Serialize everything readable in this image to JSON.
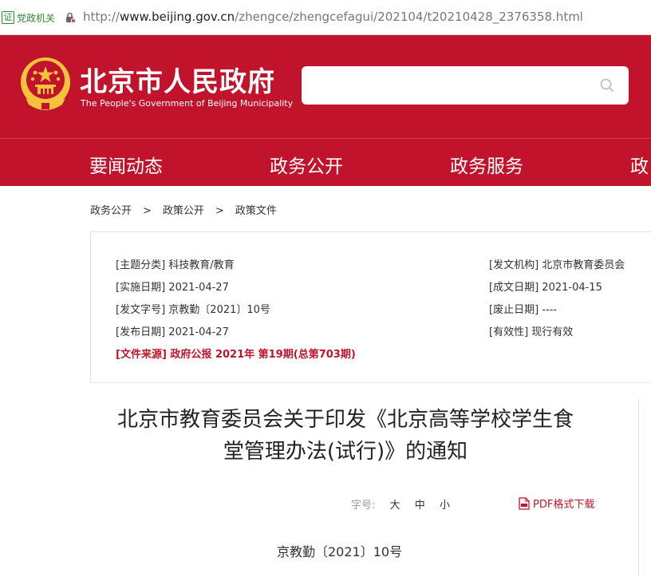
{
  "browser": {
    "cert_glyph": "证",
    "cert_label": "党政机关",
    "url_scheme": "http://",
    "url_host": "www.beijing.gov.cn",
    "url_path": "/zhengce/zhengcefagui/202104/t20210428_2376358.html"
  },
  "header": {
    "title_cn": "北京市人民政府",
    "title_en": "The People's Government of Beijing Municipality",
    "search_placeholder": ""
  },
  "nav": {
    "items": [
      "要闻动态",
      "政务公开",
      "政务服务",
      "政"
    ]
  },
  "breadcrumb": {
    "items": [
      "政务公开",
      "政策公开",
      "政策文件"
    ],
    "separator": ">"
  },
  "info": {
    "left": [
      {
        "key": "[主题分类]",
        "value": "科技教育/教育"
      },
      {
        "key": "[实施日期]",
        "value": "2021-04-27"
      },
      {
        "key": "[发文字号]",
        "value": "京教勤〔2021〕10号"
      },
      {
        "key": "[发布日期]",
        "value": "2021-04-27"
      }
    ],
    "right": [
      {
        "key": "[发文机构]",
        "value": "北京市教育委员会"
      },
      {
        "key": "[成文日期]",
        "value": "2021-04-15"
      },
      {
        "key": "[废止日期]",
        "value": "----"
      },
      {
        "key": "[有效性]",
        "value": "现行有效"
      }
    ],
    "source_key": "[文件来源]",
    "source_value": "政府公报 2021年 第19期(总第703期)"
  },
  "article": {
    "title_line1": "北京市教育委员会关于印发《北京高等学校学生食",
    "title_line2": "堂管理办法(试行)》的通知",
    "font_size_label": "字号:",
    "font_large": "大",
    "font_medium": "中",
    "font_small": "小",
    "pdf_label": "PDF格式下载",
    "doc_number": "京教勤〔2021〕10号"
  },
  "colors": {
    "brand_red": "#c1132b",
    "emblem_gold": "#f4c23c"
  }
}
